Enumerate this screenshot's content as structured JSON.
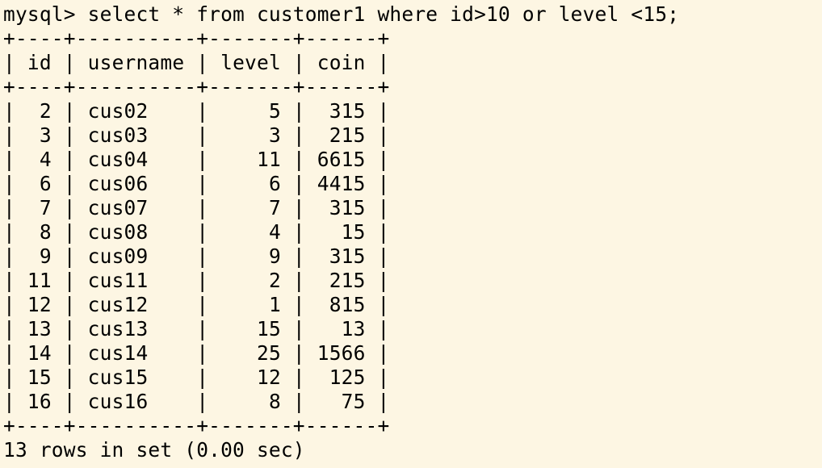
{
  "terminal": {
    "prompt": "mysql>",
    "query": "select * from customer1 where id>10 or level <15;",
    "border": "+----+----------+-------+------+",
    "headers": [
      "id",
      "username",
      "level",
      "coin"
    ],
    "rows": [
      [
        "2",
        "cus02",
        "5",
        "315"
      ],
      [
        "3",
        "cus03",
        "3",
        "215"
      ],
      [
        "4",
        "cus04",
        "11",
        "6615"
      ],
      [
        "6",
        "cus06",
        "6",
        "4415"
      ],
      [
        "7",
        "cus07",
        "7",
        "315"
      ],
      [
        "8",
        "cus08",
        "4",
        "15"
      ],
      [
        "9",
        "cus09",
        "9",
        "315"
      ],
      [
        "11",
        "cus11",
        "2",
        "215"
      ],
      [
        "12",
        "cus12",
        "1",
        "815"
      ],
      [
        "13",
        "cus13",
        "15",
        "13"
      ],
      [
        "14",
        "cus14",
        "25",
        "1566"
      ],
      [
        "15",
        "cus15",
        "12",
        "125"
      ],
      [
        "16",
        "cus16",
        "8",
        "75"
      ]
    ],
    "summary": "13 rows in set (0.00 sec)"
  }
}
